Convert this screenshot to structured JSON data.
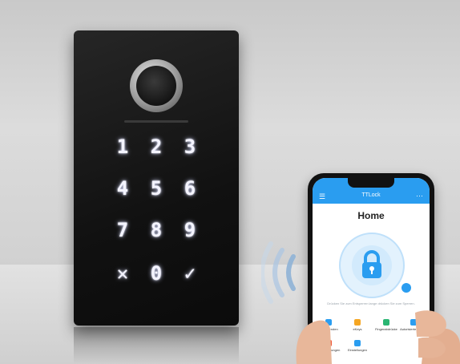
{
  "keypad": {
    "keys": [
      "1",
      "2",
      "3",
      "4",
      "5",
      "6",
      "7",
      "8",
      "9",
      "✕",
      "0",
      "✓"
    ]
  },
  "app": {
    "title": "TTLock",
    "home_title": "Home",
    "hint": "Drücken Sie zum Entsperren lange drücken Sie zum Sperren.",
    "grid": [
      {
        "label": "eKey senden",
        "color": "#2a9df0"
      },
      {
        "label": "eKeys",
        "color": "#f5a623"
      },
      {
        "label": "Fingerabdrücke",
        "color": "#2bb673"
      },
      {
        "label": "Autorisierter Admin",
        "color": "#2a9df0"
      },
      {
        "label": "Aufzeichnungen",
        "color": "#f05a3a"
      },
      {
        "label": "Einstellungen",
        "color": "#2a9df0"
      }
    ]
  },
  "colors": {
    "app_primary": "#2a9df0",
    "key_glow": "#f4f4ff"
  }
}
